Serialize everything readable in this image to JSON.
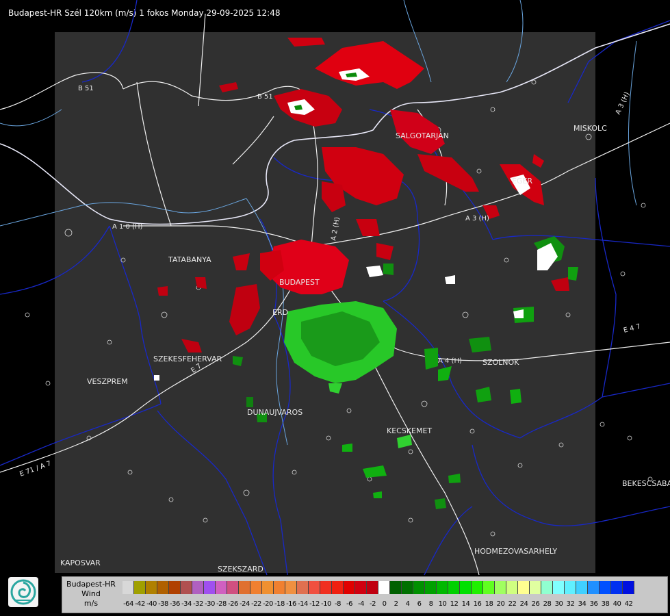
{
  "header": {
    "title": "Budapest-HR Szél 120km (m/s) 1 fokos Monday 29-09-2025 12:48"
  },
  "cities": [
    {
      "name": "SALGOTARJAN"
    },
    {
      "name": "MISKOLC"
    },
    {
      "name": "EGER"
    },
    {
      "name": "TATABANYA"
    },
    {
      "name": "BUDAPEST"
    },
    {
      "name": "SZEKESFEHERVAR"
    },
    {
      "name": "VESZPREM"
    },
    {
      "name": "DUNAUJVAROS"
    },
    {
      "name": "KECSKEMET"
    },
    {
      "name": "SZOLNOK"
    },
    {
      "name": "BEKESCSABA"
    },
    {
      "name": "HODMEZOVASARHELY"
    },
    {
      "name": "KAPOSVAR"
    },
    {
      "name": "SZEKSZARD"
    },
    {
      "name": "ERD"
    }
  ],
  "roads": [
    {
      "name": "B 51"
    },
    {
      "name": "B 51"
    },
    {
      "name": "A 1 0 (H)"
    },
    {
      "name": "A 2 (H)"
    },
    {
      "name": "A 3 (H)"
    },
    {
      "name": "A 3 (H)"
    },
    {
      "name": "A 4 (H)"
    },
    {
      "name": "E 4 7"
    },
    {
      "name": "E 71 / A 7"
    },
    {
      "name": "E 7"
    }
  ],
  "legend": {
    "line1": "Budapest-HR",
    "line2": "Wind",
    "line3": "m/s",
    "ticks": [
      "-64",
      "-42",
      "-40",
      "-38",
      "-36",
      "-34",
      "-32",
      "-30",
      "-28",
      "-26",
      "-24",
      "-22",
      "-20",
      "-18",
      "-16",
      "-14",
      "-12",
      "-10",
      "-8",
      "-6",
      "-4",
      "-2",
      "0",
      "2",
      "4",
      "6",
      "8",
      "10",
      "12",
      "14",
      "16",
      "18",
      "20",
      "22",
      "24",
      "26",
      "28",
      "30",
      "32",
      "34",
      "36",
      "38",
      "40",
      "42"
    ],
    "colors": [
      "#d8d8d8",
      "#a0a000",
      "#b08000",
      "#b06000",
      "#b04000",
      "#b05050",
      "#b060c0",
      "#a050f0",
      "#c060e0",
      "#d060c0",
      "#d05080",
      "#e07030",
      "#f08030",
      "#f09030",
      "#f08030",
      "#f09040",
      "#e07050",
      "#f05040",
      "#f03020",
      "#f02010",
      "#e00000",
      "#d00010",
      "#c00010",
      "#b00000",
      "#ffffff",
      "#006000",
      "#007000",
      "#009000",
      "#00a000",
      "#00b800",
      "#00d000",
      "#00e000",
      "#20f000",
      "#60ff20",
      "#a0ff60",
      "#d0ff80",
      "#ffff90",
      "#e0ffa0",
      "#b0ffb0",
      "#90ffd0",
      "#80ffff",
      "#60f0ff",
      "#40d0ff",
      "#2090ff",
      "#0050ff",
      "#0030f0",
      "#0010e0"
    ],
    "colorMeaning": "negative (red/orange) = approaching, positive (green/blue) = receding"
  }
}
